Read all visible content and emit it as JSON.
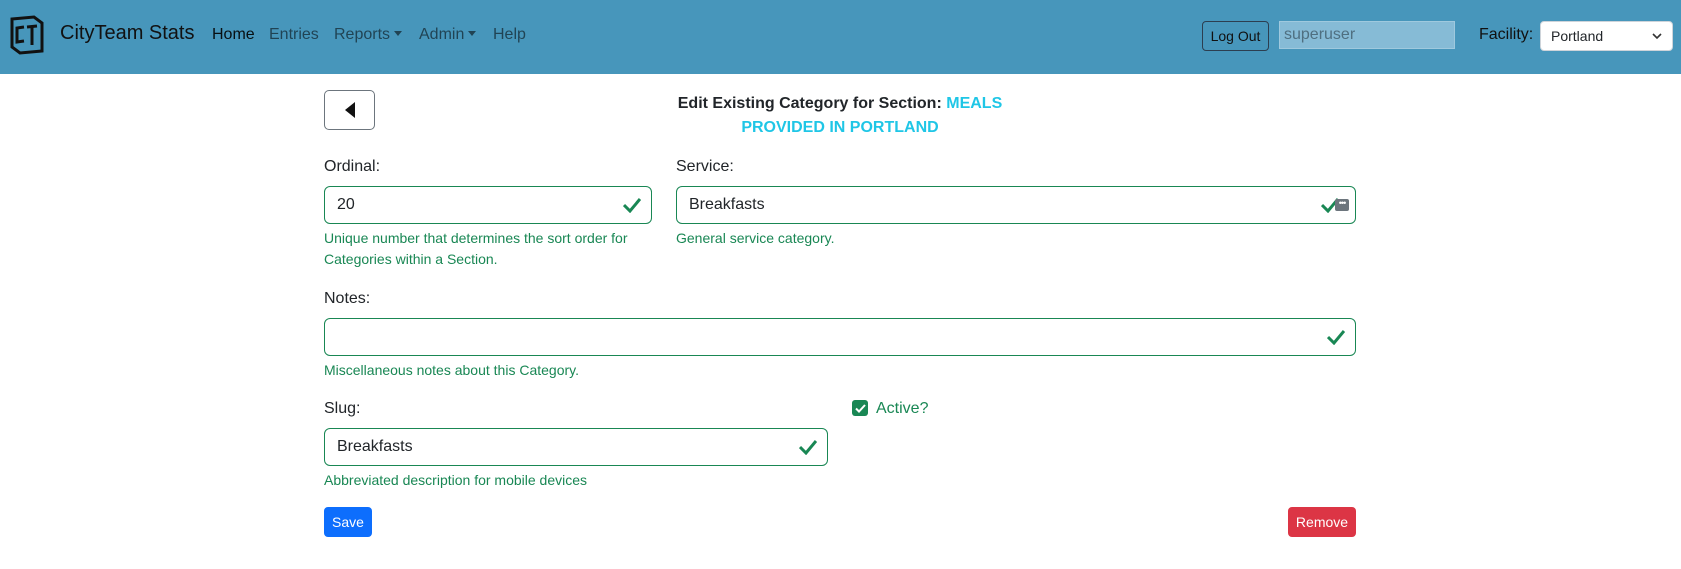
{
  "navbar": {
    "brand": "CityTeam Stats",
    "items": [
      {
        "label": "Home"
      },
      {
        "label": "Entries"
      },
      {
        "label": "Reports"
      },
      {
        "label": "Admin"
      },
      {
        "label": "Help"
      }
    ],
    "logout_label": "Log Out",
    "user_placeholder": "superuser",
    "facility_label": "Facility:",
    "facility_value": "Portland"
  },
  "page": {
    "title_prefix": "Edit Existing Category for Section:",
    "section_line1": "MEALS",
    "section_line2": "PROVIDED IN PORTLAND"
  },
  "form": {
    "ordinal": {
      "label": "Ordinal:",
      "value": "20",
      "help1": "Unique number that determines the sort order for",
      "help2": "Categories within a Section."
    },
    "service": {
      "label": "Service:",
      "value": "Breakfasts",
      "help": "General service category."
    },
    "notes": {
      "label": "Notes:",
      "value": "",
      "help": "Miscellaneous notes about this Category."
    },
    "slug": {
      "label": "Slug:",
      "value": "Breakfasts",
      "help": "Abbreviated description for mobile devices"
    },
    "active": {
      "label": "Active?",
      "checked": true
    },
    "save_label": "Save",
    "remove_label": "Remove"
  },
  "colors": {
    "navbar_bg": "#4796bb",
    "valid_green": "#198754",
    "section_cyan": "#1fc6e6",
    "primary": "#0d6efd",
    "danger": "#dc3545"
  }
}
